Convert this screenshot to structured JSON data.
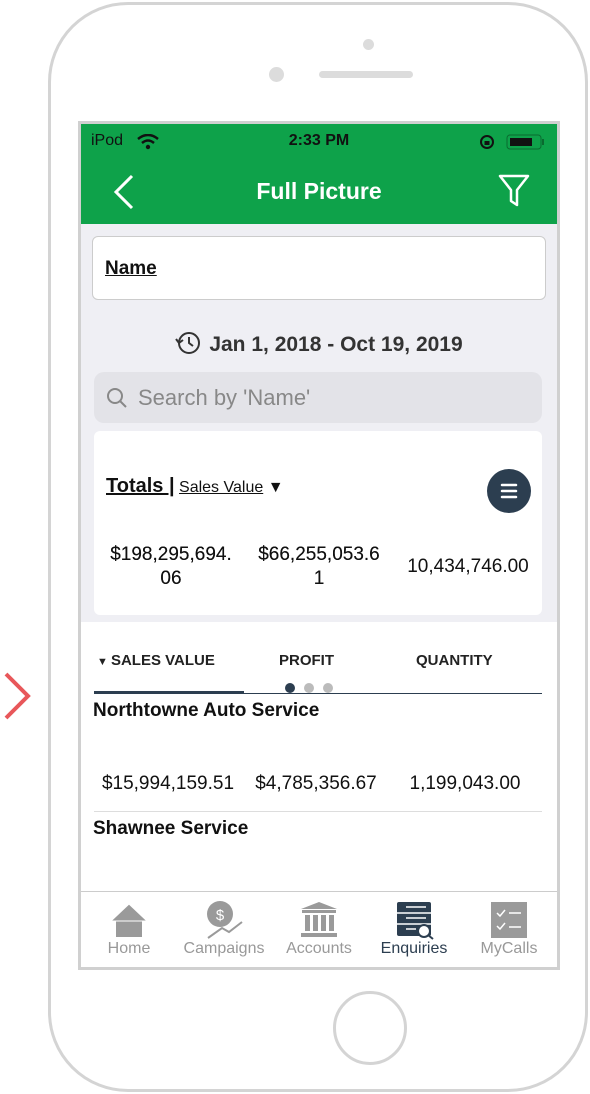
{
  "status": {
    "carrier": "iPod",
    "time": "2:33 PM"
  },
  "header": {
    "title": "Full Picture"
  },
  "name_field": {
    "label": "Name"
  },
  "date_range": "Jan 1, 2018 - Oct 19, 2019",
  "search": {
    "placeholder": "Search by 'Name'"
  },
  "totals": {
    "label": "Totals |",
    "metric": "Sales Value",
    "values": [
      "$198,295,694.06",
      "$66,255,053.61",
      "10,434,746.00"
    ],
    "value_lines": [
      [
        "$198,295,694.",
        "06"
      ],
      [
        "$66,255,053.6",
        "1"
      ],
      [
        "10,434,746.00"
      ]
    ]
  },
  "columns": [
    {
      "label": "SALES VALUE",
      "sorted": true
    },
    {
      "label": "PROFIT"
    },
    {
      "label": "QUANTITY"
    }
  ],
  "pager": {
    "pages": 3,
    "active": 1
  },
  "rows": [
    {
      "name": "Northtowne Auto Service",
      "values": [
        "$15,994,159.51",
        "$4,785,356.67",
        "1,199,043.00"
      ]
    },
    {
      "name": "Shawnee Service",
      "values": []
    }
  ],
  "tabs": [
    {
      "label": "Home"
    },
    {
      "label": "Campaigns"
    },
    {
      "label": "Accounts"
    },
    {
      "label": "Enquiries",
      "active": true
    },
    {
      "label": "MyCalls"
    }
  ],
  "colors": {
    "brand": "#0ea24a",
    "active_tab": "#2c3e50",
    "inactive_tab": "#999999"
  }
}
